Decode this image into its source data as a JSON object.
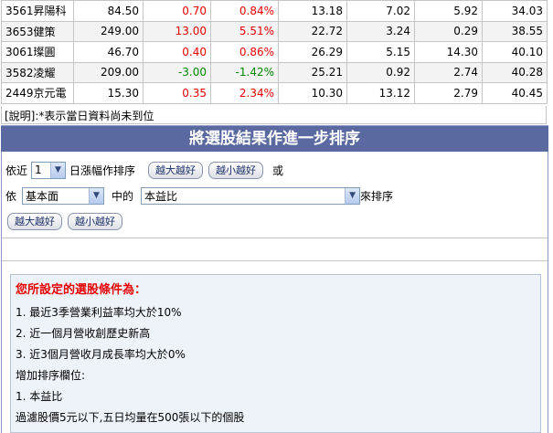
{
  "stocks": [
    {
      "name": "3561昇陽科",
      "c1": "84.50",
      "c2": "0.70",
      "c3": "0.84%",
      "c4": "13.18",
      "c5": "7.02",
      "c6": "5.92",
      "c7": "34.03",
      "dir": "up"
    },
    {
      "name": "3653健策",
      "c1": "249.00",
      "c2": "13.00",
      "c3": "5.51%",
      "c4": "22.72",
      "c5": "3.24",
      "c6": "0.29",
      "c7": "38.55",
      "dir": "up"
    },
    {
      "name": "3061璨圓",
      "c1": "46.70",
      "c2": "0.40",
      "c3": "0.86%",
      "c4": "26.29",
      "c5": "5.15",
      "c6": "14.30",
      "c7": "40.10",
      "dir": "up"
    },
    {
      "name": "3582凌耀",
      "c1": "209.00",
      "c2": "-3.00",
      "c3": "-1.42%",
      "c4": "25.21",
      "c5": "0.92",
      "c6": "2.74",
      "c7": "40.28",
      "dir": "down"
    },
    {
      "name": "2449京元電",
      "c1": "15.30",
      "c2": "0.35",
      "c3": "2.34%",
      "c4": "10.30",
      "c5": "13.12",
      "c6": "2.79",
      "c7": "40.45",
      "dir": "up"
    }
  ],
  "note": "[說明]:*表示當日資料尚未到位",
  "section_title": "將選股結果作進一步排序",
  "sort1": {
    "prefix": "依近",
    "days_value": "1",
    "label": "日漲幅作排序",
    "btn_desc": "越大越好",
    "btn_asc": "越小越好",
    "suffix": "或"
  },
  "sort2": {
    "prefix": "依",
    "category_value": "基本面",
    "middle": "中的",
    "field_value": "本益比",
    "suffix": "來排序",
    "btn_desc": "越大越好",
    "btn_asc": "越小越好"
  },
  "conditions": {
    "title": "您所設定的選股條件為：",
    "items": [
      "1. 最近3季營業利益率均大於10%",
      "2. 近一個月營收創歷史新高",
      "3. 近3個月營收月成長率均大於0%",
      "增加排序欄位:",
      "1. 本益比",
      "過濾股價5元以下,五日均量在500張以下的個股"
    ]
  },
  "colors": {
    "up": "#e60000",
    "down": "#008800",
    "section_bar": "#5a6aa0",
    "condition_title": "#e60000"
  },
  "icons": {
    "dropdown": "chevron-down-icon"
  }
}
